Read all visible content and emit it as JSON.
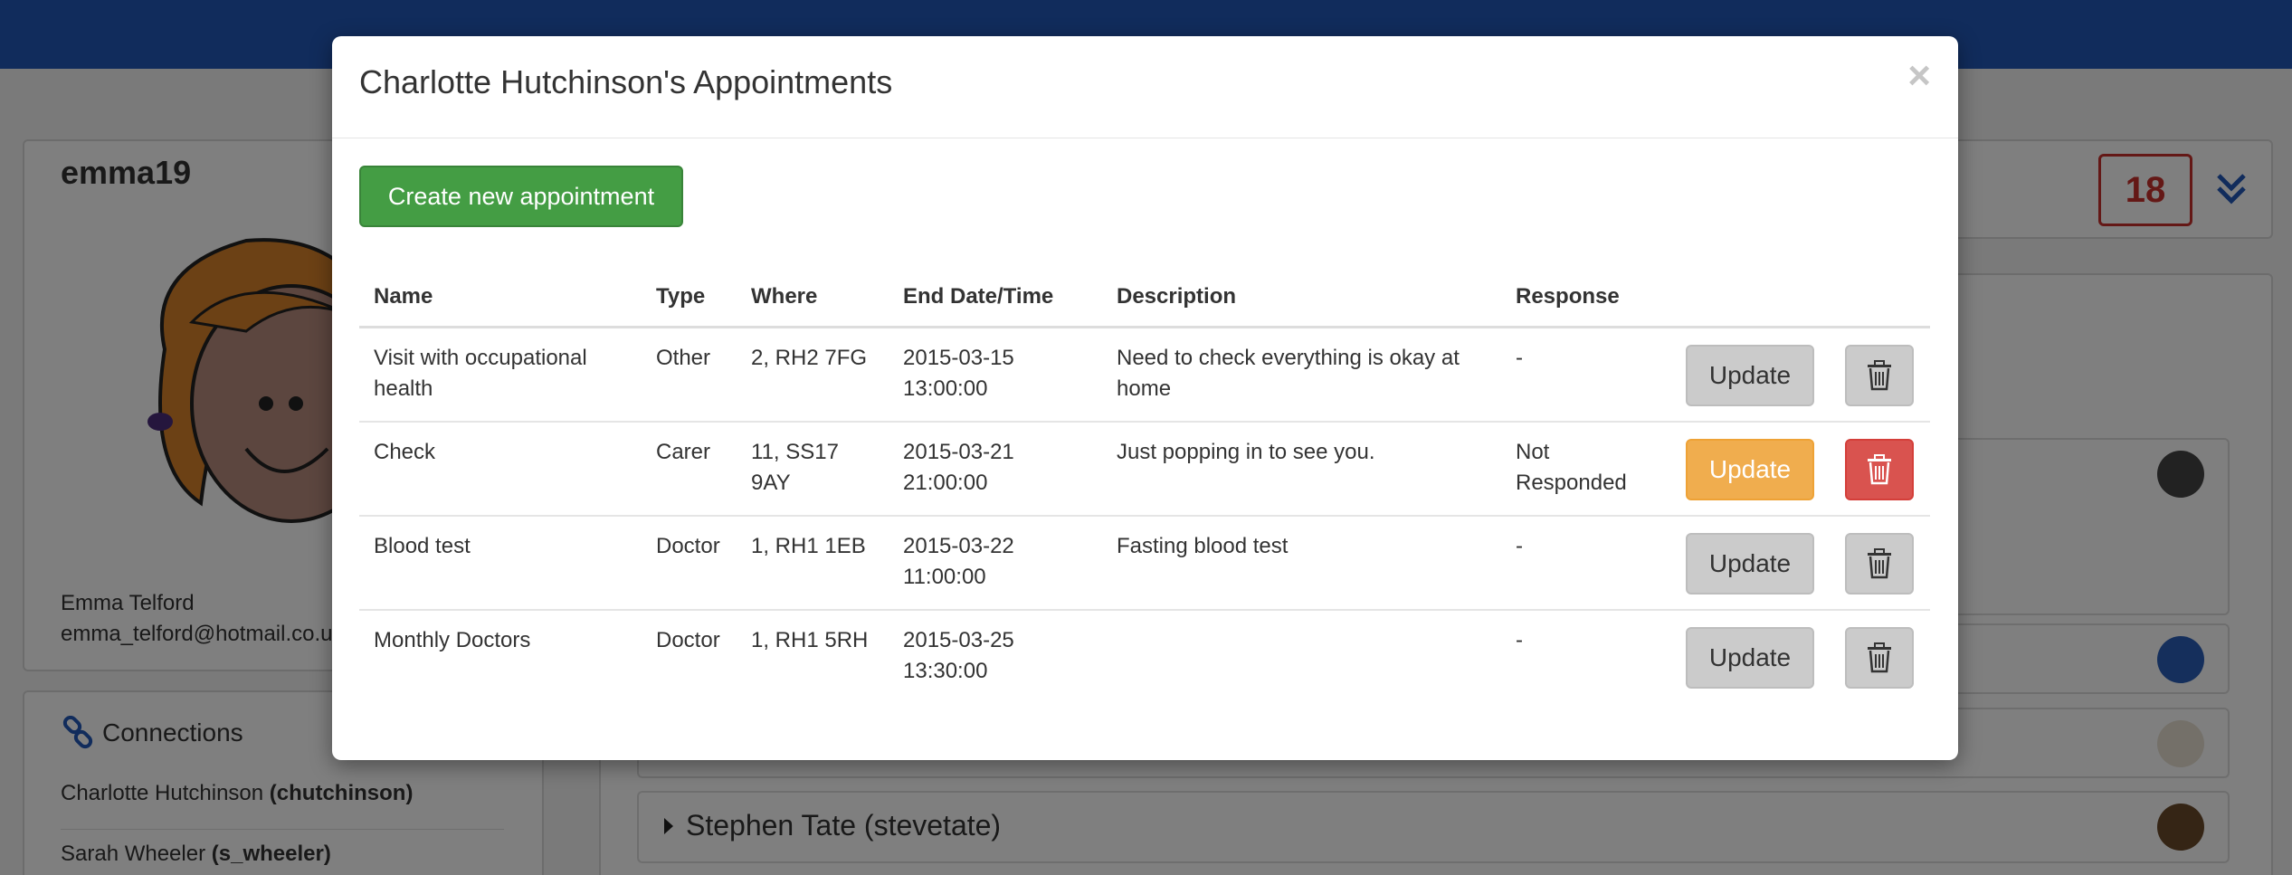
{
  "background": {
    "profile": {
      "username": "emma19",
      "full_name": "Emma Telford",
      "email": "emma_telford@hotmail.co.uk"
    },
    "connections": {
      "title": "Connections",
      "items": [
        {
          "name": "Charlotte Hutchinson",
          "handle": "(chutchinson)"
        },
        {
          "name": "Sarah Wheeler",
          "handle": "(s_wheeler)"
        }
      ]
    },
    "notification_count": "18",
    "list_item_visible": "Stephen Tate (stevetate)"
  },
  "modal": {
    "title": "Charlotte Hutchinson's Appointments",
    "close_glyph": "×",
    "create_button": "Create new appointment",
    "columns": [
      "Name",
      "Type",
      "Where",
      "End Date/Time",
      "Description",
      "Response"
    ],
    "rows": [
      {
        "name": "Visit with occupational health",
        "type": "Other",
        "where": "2, RH2 7FG",
        "end_date": "2015-03-15",
        "end_time": "13:00:00",
        "description": "Need to check everything is okay at home",
        "response": "-",
        "update_label": "Update",
        "state": "default"
      },
      {
        "name": "Check",
        "type": "Carer",
        "where": "11, SS17 9AY",
        "end_date": "2015-03-21",
        "end_time": "21:00:00",
        "description": "Just popping in to see you.",
        "response": "Not Responded",
        "update_label": "Update",
        "state": "highlighted"
      },
      {
        "name": "Blood test",
        "type": "Doctor",
        "where": "1, RH1 1EB",
        "end_date": "2015-03-22",
        "end_time": "11:00:00",
        "description": "Fasting blood test",
        "response": "-",
        "update_label": "Update",
        "state": "default"
      },
      {
        "name": "Monthly Doctors",
        "type": "Doctor",
        "where": "1, RH1 5RH",
        "end_date": "2015-03-25",
        "end_time": "13:30:00",
        "description": "",
        "response": "-",
        "update_label": "Update",
        "state": "default"
      }
    ]
  },
  "colors": {
    "navbar": "#2259b8",
    "success": "#449d44",
    "warning": "#f0ad4e",
    "danger": "#d9534f",
    "badge": "#c9302c"
  },
  "icons": {
    "delete": "trash-icon",
    "close": "close-icon",
    "connections": "link-icon",
    "expand": "double-chevron-down-icon"
  }
}
